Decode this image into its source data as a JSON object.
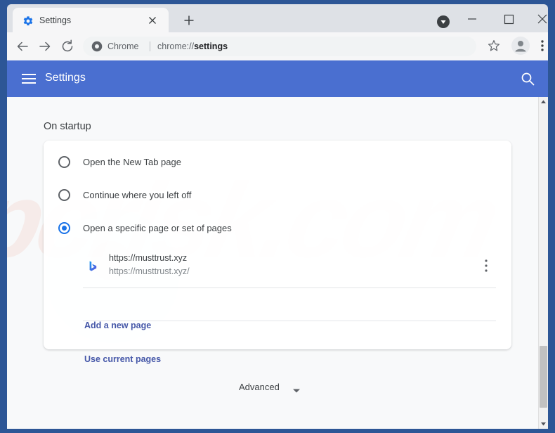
{
  "window": {
    "frame_color": "#2d5696",
    "controls": {
      "minimize": "minimize-button",
      "maximize": "maximize-button",
      "close": "close-button"
    }
  },
  "tabstrip": {
    "tabs": [
      {
        "title": "Settings",
        "favicon": "gear-icon",
        "active": true
      }
    ],
    "close_label": "×",
    "new_tab_label": "+",
    "download_indicator": "download-icon"
  },
  "toolbar": {
    "back": "back-arrow-icon",
    "forward": "forward-arrow-icon",
    "reload": "reload-icon",
    "omnibox": {
      "chrome_icon": "chrome-logo-icon",
      "scheme_label": "Chrome",
      "url_prefix": "chrome://",
      "url_bold": "settings",
      "full_url": "chrome://settings"
    },
    "bookmark_star": "star-icon",
    "profile": "avatar-icon",
    "menu": "three-dot-menu-icon"
  },
  "settings": {
    "header": {
      "menu_icon": "hamburger-icon",
      "title": "Settings",
      "search_icon": "search-icon",
      "color": "#4a6fd0"
    },
    "section_title": "On startup",
    "startup_options": [
      {
        "label": "Open the New Tab page",
        "selected": false
      },
      {
        "label": "Continue where you left off",
        "selected": false
      },
      {
        "label": "Open a specific page or set of pages",
        "selected": true
      }
    ],
    "startup_pages": [
      {
        "name": "https://musttrust.xyz",
        "url": "https://musttrust.xyz/",
        "favicon": "bing-b-icon",
        "menu_icon": "three-dot-menu-icon"
      }
    ],
    "links": {
      "add_new_page": "Add a new page",
      "use_current_pages": "Use current pages"
    },
    "advanced": {
      "label": "Advanced",
      "chevron": "chevron-down-icon"
    },
    "accent_color": "#1a73e8",
    "link_color": "#4557a8"
  },
  "watermark": {
    "text": "pcrisk.com"
  },
  "scrollbar": {
    "up_arrow": "scroll-up-icon",
    "down_arrow": "scroll-down-icon"
  }
}
